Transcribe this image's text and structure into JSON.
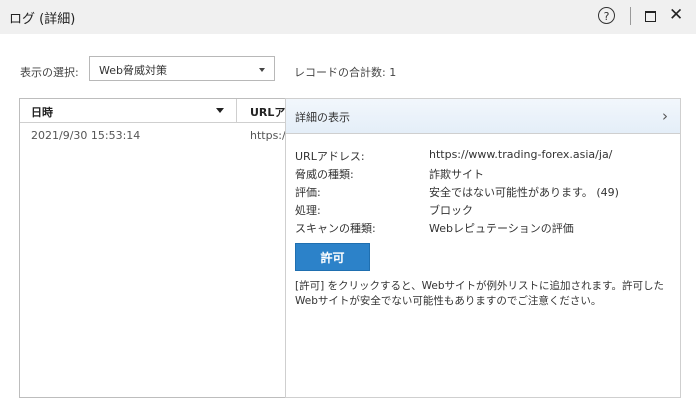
{
  "window": {
    "title": "ログ (詳細)",
    "help_label": "?"
  },
  "toolbar": {
    "view_label": "表示の選択:",
    "view_value": "Web脅威対策",
    "record_count": "レコードの合計数: 1"
  },
  "table": {
    "columns": [
      "日時",
      "URLア"
    ],
    "rows": [
      {
        "date": "2021/9/30 15:53:14",
        "url": "https:/"
      }
    ]
  },
  "details": {
    "header": "詳細の表示",
    "fields": [
      {
        "label": "URLアドレス:",
        "value": "https://www.trading-forex.asia/ja/"
      },
      {
        "label": "脅威の種類:",
        "value": "詐欺サイト"
      },
      {
        "label": "評価:",
        "value": "安全ではない可能性があります。 (49)"
      },
      {
        "label": "処理:",
        "value": "ブロック"
      },
      {
        "label": "スキャンの種類:",
        "value": "Webレピュテーションの評価"
      }
    ],
    "allow_button": "許可",
    "note": "[許可] をクリックすると、Webサイトが例外リストに追加されます。許可したWebサイトが安全でない可能性もありますのでご注意ください。"
  },
  "colors": {
    "accent": "#2c82c9",
    "titlebar_bg": "#f0f0f0",
    "panel_header_bg": "#e8f1fa"
  }
}
